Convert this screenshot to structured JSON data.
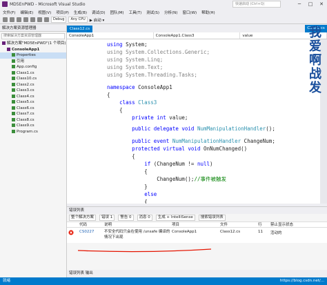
{
  "window": {
    "title": "MD5EnPWD - Microsoft Visual Studio",
    "quick_launch": "快速启动 (Ctrl+Q)"
  },
  "menu": [
    "文件(F)",
    "编辑(E)",
    "视图(V)",
    "项目(P)",
    "生成(B)",
    "调试(D)",
    "团队(M)",
    "工具(T)",
    "测试(S)",
    "分析(N)",
    "窗口(W)",
    "帮助(H)"
  ],
  "toolbar": {
    "config": "Debug",
    "platform": "Any CPU",
    "start_label": "▶ 启动 ▾"
  },
  "solution_explorer": {
    "title": "解决方案资源管理器",
    "search_placeholder": "搜索解决方案资源管理器",
    "items": [
      {
        "label": "解决方案\"MD5EnPWD\"(1 个项目)",
        "indent": 0
      },
      {
        "label": "ConsoleApp1",
        "indent": 1,
        "bold": true
      },
      {
        "label": "Properties",
        "indent": 2,
        "selected": true
      },
      {
        "label": "引用",
        "indent": 2
      },
      {
        "label": "App.config",
        "indent": 2
      },
      {
        "label": "Class1.cs",
        "indent": 2
      },
      {
        "label": "Class10.cs",
        "indent": 2
      },
      {
        "label": "Class2.cs",
        "indent": 2
      },
      {
        "label": "Class3.cs",
        "indent": 2
      },
      {
        "label": "Class4.cs",
        "indent": 2
      },
      {
        "label": "Class5.cs",
        "indent": 2
      },
      {
        "label": "Class6.cs",
        "indent": 2
      },
      {
        "label": "Class7.cs",
        "indent": 2
      },
      {
        "label": "Class8.cs",
        "indent": 2
      },
      {
        "label": "Class9.cs",
        "indent": 2
      },
      {
        "label": "Program.cs",
        "indent": 2
      }
    ]
  },
  "editor": {
    "tab": "Class12.cs",
    "right_tab": "Class3.cs",
    "nav": [
      "ConsoleApp1",
      "ConsoleApp1.Class3",
      "value"
    ],
    "zoom": "100 %"
  },
  "watermark": "我爱啊战发",
  "error_list": {
    "title": "错误列表",
    "scope": "整个解决方案",
    "errors": "错误 1",
    "warnings": "警告 0",
    "messages": "消息 0",
    "build": "生成 + IntelliSense",
    "search": "搜索错误列表",
    "columns": [
      "",
      "代码",
      "说明",
      "项目",
      "文件",
      "行",
      "禁止显示状态"
    ],
    "rows": [
      {
        "code": "CS0227",
        "desc": "不安全代码只会在使用 /unsafe 编译的情况下出现",
        "project": "ConsoleApp1",
        "file": "Class12.cs",
        "line": "11",
        "state": "活动的"
      }
    ],
    "footer": "错误列表  输出"
  },
  "status": {
    "left": "就绪",
    "right": "https://blog.csdn.net/..."
  }
}
